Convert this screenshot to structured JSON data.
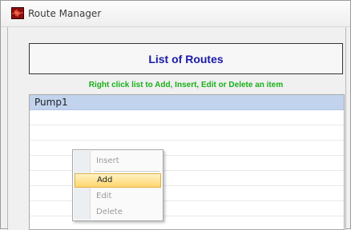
{
  "window": {
    "title": "Route Manager",
    "icon": "waveform-app-icon"
  },
  "main": {
    "heading": "List of Routes",
    "hint": "Right click list to Add, Insert, Edit or Delete an item"
  },
  "list": {
    "items": [
      "Pump1"
    ],
    "selected_index": 0
  },
  "context_menu": {
    "items": [
      {
        "label": "Insert",
        "enabled": false,
        "highlighted": false
      },
      {
        "label": "Add",
        "enabled": true,
        "highlighted": true
      },
      {
        "label": "Edit",
        "enabled": false,
        "highlighted": false
      },
      {
        "label": "Delete",
        "enabled": false,
        "highlighted": false
      }
    ]
  },
  "colors": {
    "heading": "#1a1aa8",
    "hint": "#19b019",
    "selection": "#c2d3ee",
    "menu_highlight": "#ffd56c"
  }
}
